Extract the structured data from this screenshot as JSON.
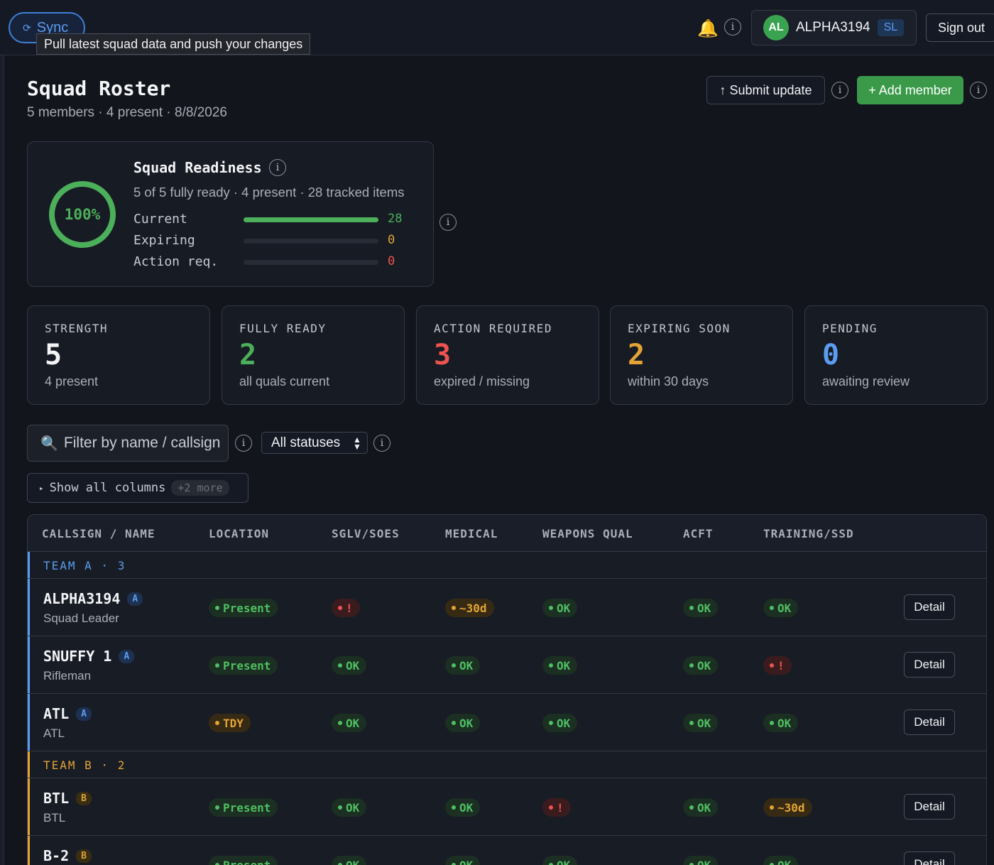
{
  "topbar": {
    "sync_label": "Sync",
    "sync_icon": "⟳",
    "tooltip": "Pull latest squad data and push your changes",
    "bell_icon": "🔔",
    "info_glyph": "i",
    "user": {
      "initials": "AL",
      "name": "ALPHA3194",
      "role": "SL"
    },
    "signout_label": "Sign out"
  },
  "page": {
    "title": "Squad Roster",
    "subtitle": "5 members · 4 present · 8/8/2026",
    "submit_label": "↑ Submit update",
    "add_label": "+ Add member"
  },
  "readiness": {
    "title": "Squad Readiness",
    "percent_label": "100%",
    "percent": 1.0,
    "subtitle": "5 of 5 fully ready · 4 present · 28 tracked items",
    "bars": [
      {
        "label": "Current",
        "value": "28",
        "fraction": 1.0,
        "color": "#4caf5a"
      },
      {
        "label": "Expiring",
        "value": "0",
        "fraction": 0,
        "color": "#e3a335"
      },
      {
        "label": "Action req.",
        "value": "0",
        "fraction": 0,
        "color": "#ef5350"
      }
    ]
  },
  "stats": [
    {
      "label": "STRENGTH",
      "value": "5",
      "sub": "4 present",
      "color": "#f3f4f6"
    },
    {
      "label": "FULLY READY",
      "value": "2",
      "sub": "all quals current",
      "color": "#4caf5a"
    },
    {
      "label": "ACTION REQUIRED",
      "value": "3",
      "sub": "expired / missing",
      "color": "#ef5350"
    },
    {
      "label": "EXPIRING SOON",
      "value": "2",
      "sub": "within 30 days",
      "color": "#e3a335"
    },
    {
      "label": "PENDING",
      "value": "0",
      "sub": "awaiting review",
      "color": "#5c9cf0"
    }
  ],
  "filters": {
    "search_icon": "🔍",
    "search_placeholder": "Filter by name / callsign",
    "status_value": "All statuses",
    "status_arrow": "⌃⌄",
    "show_cols_arrow": "▸",
    "show_cols_label": "Show all columns",
    "show_cols_more": "+2 more"
  },
  "table": {
    "headers": [
      "CALLSIGN / NAME",
      "LOCATION",
      "SGLV/SOES",
      "MEDICAL",
      "WEAPONS QUAL",
      "ACFT",
      "TRAINING/SSD"
    ],
    "detail_label": "Detail",
    "groups": [
      {
        "label": "TEAM A · 3",
        "color": "#5c9cf0"
      },
      {
        "label": "TEAM B · 2",
        "color": "#e3a335"
      }
    ],
    "rows": [
      {
        "callsign": "ALPHA3194",
        "team": "A",
        "role": "Squad Leader",
        "cells": [
          {
            "t": "Present",
            "s": "ok"
          },
          {
            "t": "!",
            "s": "err"
          },
          {
            "t": "~30d",
            "s": "warn"
          },
          {
            "t": "OK",
            "s": "ok"
          },
          {
            "t": "OK",
            "s": "ok"
          },
          {
            "t": "OK",
            "s": "ok"
          }
        ]
      },
      {
        "callsign": "SNUFFY 1",
        "team": "A",
        "role": "Rifleman",
        "cells": [
          {
            "t": "Present",
            "s": "ok"
          },
          {
            "t": "OK",
            "s": "ok"
          },
          {
            "t": "OK",
            "s": "ok"
          },
          {
            "t": "OK",
            "s": "ok"
          },
          {
            "t": "OK",
            "s": "ok"
          },
          {
            "t": "!",
            "s": "err"
          }
        ]
      },
      {
        "callsign": "ATL",
        "team": "A",
        "role": "ATL",
        "cells": [
          {
            "t": "TDY",
            "s": "warn"
          },
          {
            "t": "OK",
            "s": "ok"
          },
          {
            "t": "OK",
            "s": "ok"
          },
          {
            "t": "OK",
            "s": "ok"
          },
          {
            "t": "OK",
            "s": "ok"
          },
          {
            "t": "OK",
            "s": "ok"
          }
        ]
      },
      {
        "callsign": "BTL",
        "team": "B",
        "role": "BTL",
        "cells": [
          {
            "t": "Present",
            "s": "ok"
          },
          {
            "t": "OK",
            "s": "ok"
          },
          {
            "t": "OK",
            "s": "ok"
          },
          {
            "t": "!",
            "s": "err"
          },
          {
            "t": "OK",
            "s": "ok"
          },
          {
            "t": "~30d",
            "s": "warn"
          }
        ]
      },
      {
        "callsign": "B-2",
        "team": "B",
        "role": "",
        "cells": [
          {
            "t": "Present",
            "s": "ok"
          },
          {
            "t": "OK",
            "s": "ok"
          },
          {
            "t": "OK",
            "s": "ok"
          },
          {
            "t": "OK",
            "s": "ok"
          },
          {
            "t": "OK",
            "s": "ok"
          },
          {
            "t": "OK",
            "s": "ok"
          }
        ]
      }
    ]
  }
}
